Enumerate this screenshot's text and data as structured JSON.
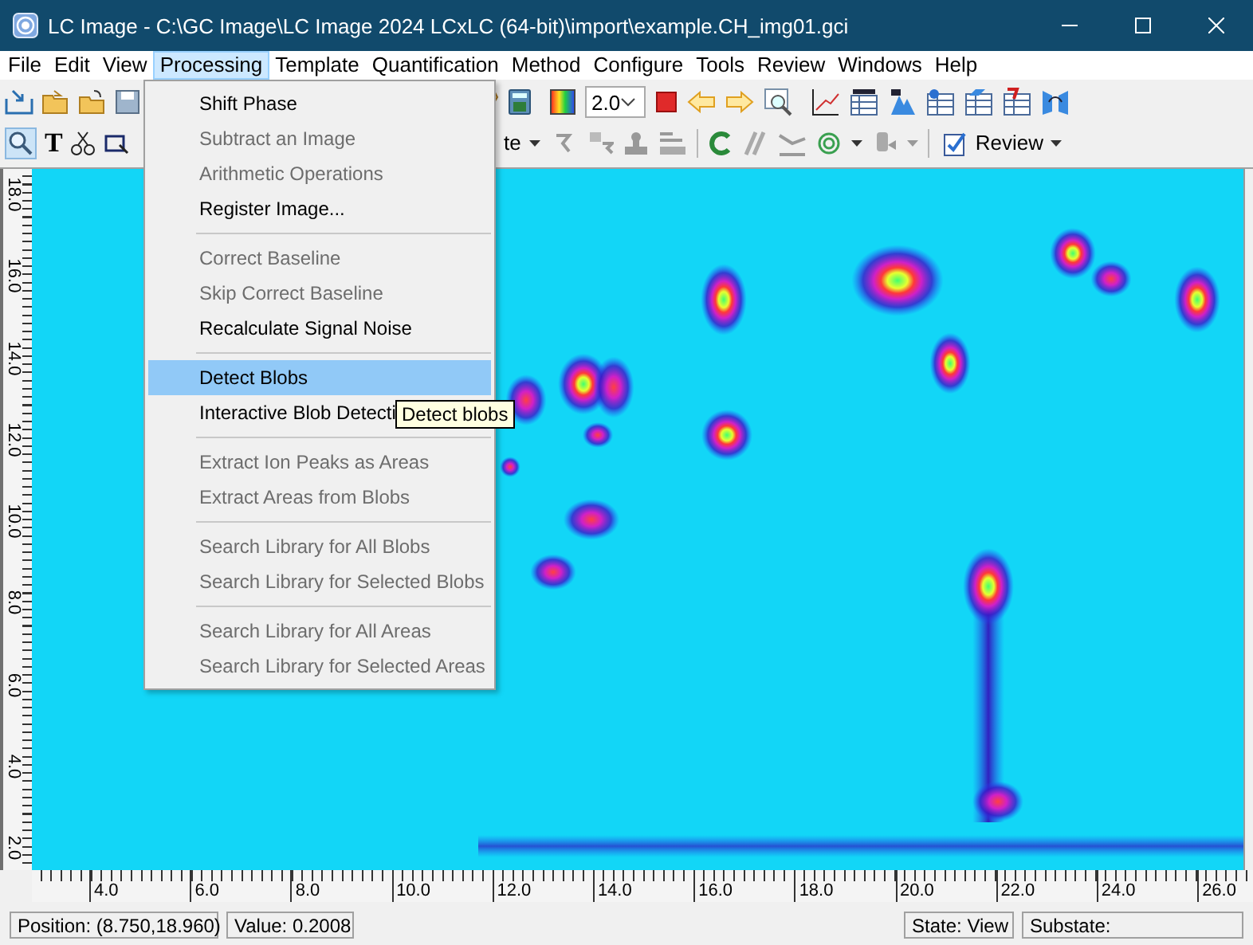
{
  "window": {
    "title": "LC Image - C:\\GC Image\\LC Image 2024 LCxLC (64-bit)\\import\\example.CH_img01.gci"
  },
  "menu_bar": [
    {
      "label": "File",
      "selected": false
    },
    {
      "label": "Edit",
      "selected": false
    },
    {
      "label": "View",
      "selected": false
    },
    {
      "label": "Processing",
      "selected": true
    },
    {
      "label": "Template",
      "selected": false
    },
    {
      "label": "Quantification",
      "selected": false
    },
    {
      "label": "Method",
      "selected": false
    },
    {
      "label": "Configure",
      "selected": false
    },
    {
      "label": "Tools",
      "selected": false
    },
    {
      "label": "Review",
      "selected": false
    },
    {
      "label": "Windows",
      "selected": false
    },
    {
      "label": "Help",
      "selected": false
    }
  ],
  "toolbar": {
    "zoom_tool": {
      "selected": true
    },
    "text_tool": "T",
    "scale_combo": {
      "value": "2.0"
    },
    "partial_dropdown": "te",
    "review_button": "Review"
  },
  "processing_menu": [
    {
      "kind": "item",
      "label": "Shift Phase",
      "disabled": false,
      "selected": false
    },
    {
      "kind": "item",
      "label": "Subtract an Image",
      "disabled": true,
      "selected": false
    },
    {
      "kind": "item",
      "label": "Arithmetic Operations",
      "disabled": true,
      "selected": false
    },
    {
      "kind": "item",
      "label": "Register Image...",
      "disabled": false,
      "selected": false
    },
    {
      "kind": "separator"
    },
    {
      "kind": "item",
      "label": "Correct Baseline",
      "disabled": true,
      "selected": false
    },
    {
      "kind": "item",
      "label": "Skip Correct Baseline",
      "disabled": true,
      "selected": false
    },
    {
      "kind": "item",
      "label": "Recalculate Signal Noise",
      "disabled": false,
      "selected": false
    },
    {
      "kind": "separator"
    },
    {
      "kind": "item",
      "label": "Detect Blobs",
      "disabled": false,
      "selected": true
    },
    {
      "kind": "item",
      "label": "Interactive Blob Detecti",
      "disabled": false,
      "selected": false
    },
    {
      "kind": "separator"
    },
    {
      "kind": "item",
      "label": "Extract Ion Peaks as Areas",
      "disabled": true,
      "selected": false
    },
    {
      "kind": "item",
      "label": "Extract Areas from Blobs",
      "disabled": true,
      "selected": false
    },
    {
      "kind": "separator"
    },
    {
      "kind": "item",
      "label": "Search Library for All Blobs",
      "disabled": true,
      "selected": false
    },
    {
      "kind": "item",
      "label": "Search Library for Selected Blobs",
      "disabled": true,
      "selected": false
    },
    {
      "kind": "separator"
    },
    {
      "kind": "item",
      "label": "Search Library for All Areas",
      "disabled": true,
      "selected": false
    },
    {
      "kind": "item",
      "label": "Search Library for Selected Areas",
      "disabled": true,
      "selected": false
    }
  ],
  "tooltip": "Detect blobs",
  "plot": {
    "y_ruler": [
      "18.0",
      "16.0",
      "14.0",
      "12.0",
      "10.0",
      "8.0",
      "6.0",
      "4.0",
      "2.0"
    ],
    "x_ruler": [
      "4.0",
      "6.0",
      "8.0",
      "10.0",
      "12.0",
      "14.0",
      "16.0",
      "18.0",
      "20.0",
      "22.0",
      "24.0",
      "26.0"
    ]
  },
  "status_bar": {
    "left": [
      "Position: (8.750,18.960)",
      "Value: 0.2008"
    ],
    "right": [
      "State: View",
      "Substate:"
    ]
  }
}
